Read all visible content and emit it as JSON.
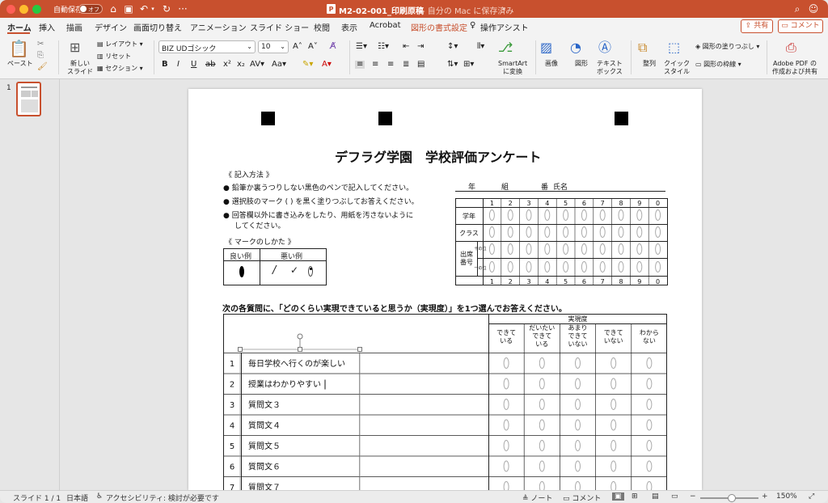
{
  "window": {
    "autosave_label": "自動保存",
    "autosave_state": "オフ",
    "doc_title": "M2-02-001_印刷原稿",
    "save_status": "- 自分の Mac に保存済み"
  },
  "tabs": [
    "ホーム",
    "挿入",
    "描画",
    "デザイン",
    "画面切り替え",
    "アニメーション",
    "スライド ショー",
    "校閲",
    "表示",
    "Acrobat",
    "図形の書式設定",
    "操作アシスト"
  ],
  "share": {
    "share_label": "共有",
    "comment_label": "コメント"
  },
  "ribbon": {
    "paste": "ペースト",
    "new_slide": "新しい\nスライド",
    "layout": "レイアウト",
    "reset": "リセット",
    "section": "セクション",
    "font_name": "BIZ UDゴシック",
    "font_size": "10",
    "smartart": "SmartArt\nに変換",
    "image": "画像",
    "shape": "図形",
    "textbox": "テキスト\nボックス",
    "arrange": "整列",
    "quick_style": "クイック\nスタイル",
    "fill": "図形の塗りつぶし",
    "outline": "図形の枠線",
    "adobe": "Adobe PDF の\n作成および共有"
  },
  "slide_panel": {
    "number": "1"
  },
  "slide": {
    "title": "デフラグ学園　学校評価アンケート",
    "howto_heading": "《 記入方法 》",
    "inst": [
      "鉛筆か裏うつりしない黒色のペンで記入してください。",
      "選択肢のマーク ( ) を黒く塗りつぶしてお答えください。",
      "回答欄以外に書き込みをしたり、用紙を汚さないように",
      "してください。"
    ],
    "mark_heading": "《 マークのしかた 》",
    "good_label": "良い例",
    "bad_label": "悪い例",
    "year_label": "年",
    "class_label": "組",
    "num_label": "番",
    "name_label": "氏名",
    "id_rows": [
      "学年",
      "クラス",
      "出席\n番号"
    ],
    "id_sub": [
      "十の位",
      "一の位"
    ],
    "digits": [
      "1",
      "2",
      "3",
      "4",
      "5",
      "6",
      "7",
      "8",
      "9",
      "0"
    ],
    "question_prompt": "次の各質問に、「どのくらい実現できていると思うか（実現度）」を1つ選んでお答えください。",
    "scale_header": "実現度",
    "scale": [
      "できて\nいる",
      "だいたい\nできて\nいる",
      "あまり\nできて\nいない",
      "できて\nいない",
      "わから\nない"
    ],
    "questions": [
      {
        "no": "1",
        "text": "毎日学校へ行くのが楽しい"
      },
      {
        "no": "2",
        "text": "授業はわかりやすい"
      },
      {
        "no": "3",
        "text": "質問文３"
      },
      {
        "no": "4",
        "text": "質問文４"
      },
      {
        "no": "5",
        "text": "質問文５"
      },
      {
        "no": "6",
        "text": "質問文６"
      },
      {
        "no": "7",
        "text": "質問文７"
      }
    ]
  },
  "status": {
    "slide_of": "スライド 1 / 1",
    "language": "日本語",
    "accessibility": "アクセシビリティ: 検討が必要です",
    "notes": "ノート",
    "comments": "コメント",
    "zoom": "150%"
  }
}
